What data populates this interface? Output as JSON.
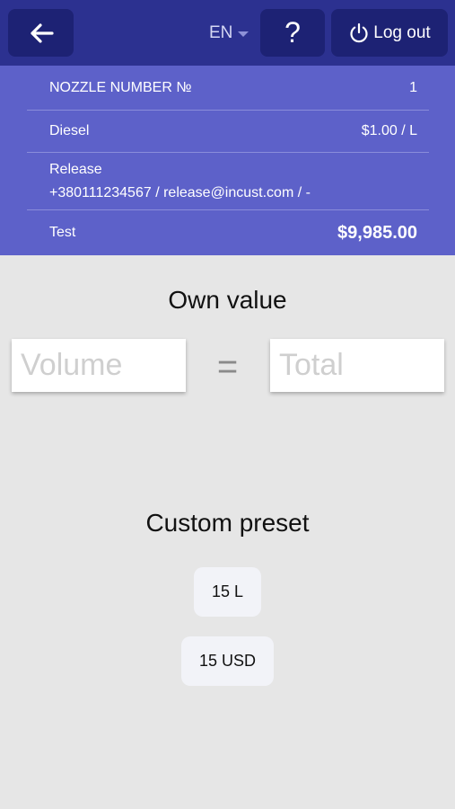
{
  "header": {
    "language": "EN",
    "help_label": "?",
    "logout_label": "Log out"
  },
  "info": {
    "nozzle_label": "NOZZLE NUMBER №",
    "nozzle_value": "1",
    "fuel_name": "Diesel",
    "fuel_price": "$1.00 / L",
    "customer_name": "Release",
    "customer_contact": "+380111234567 / release@incust.com / -",
    "account_name": "Test",
    "account_balance": "$9,985.00"
  },
  "own_value": {
    "title": "Own value",
    "volume_placeholder": "Volume",
    "equals": "=",
    "total_placeholder": "Total"
  },
  "custom_preset": {
    "title": "Custom preset",
    "presets": [
      "15 L",
      "15 USD"
    ]
  },
  "colors": {
    "topbar": "#2c3190",
    "topbar_button": "#1d2274",
    "info_panel": "#5d61c9",
    "background": "#e6e6e6"
  }
}
